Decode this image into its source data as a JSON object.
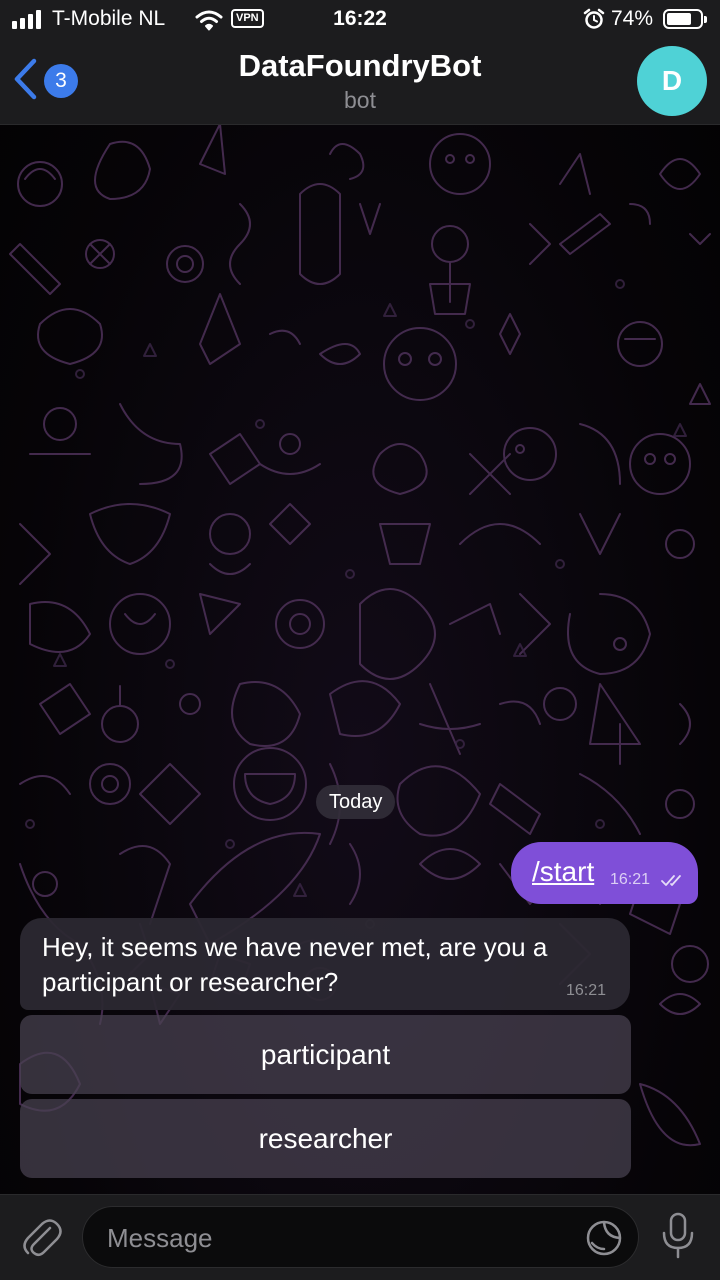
{
  "status_bar": {
    "carrier": "T-Mobile NL",
    "vpn_label": "VPN",
    "time": "16:22",
    "battery_percent": "74%",
    "battery_level": 0.74,
    "icons": [
      "signal-icon",
      "wifi-icon",
      "vpn-icon",
      "alarm-icon",
      "battery-icon"
    ]
  },
  "header": {
    "back_count": "3",
    "title": "DataFoundryBot",
    "subtitle": "bot",
    "avatar_letter": "D",
    "avatar_color": "#4fd2d6"
  },
  "chat": {
    "date_separator": "Today",
    "messages": [
      {
        "direction": "outgoing",
        "text": "/start",
        "time": "16:21",
        "status": "read",
        "bubble_color": "#7f4fd8"
      },
      {
        "direction": "incoming",
        "text": "Hey, it seems we have never met, are you a participant or researcher?",
        "time": "16:21"
      }
    ],
    "keyboard_buttons": [
      {
        "label": "participant"
      },
      {
        "label": "researcher"
      }
    ]
  },
  "input_bar": {
    "placeholder": "Message",
    "icons": [
      "attach-icon",
      "sticker-icon",
      "microphone-icon"
    ]
  }
}
